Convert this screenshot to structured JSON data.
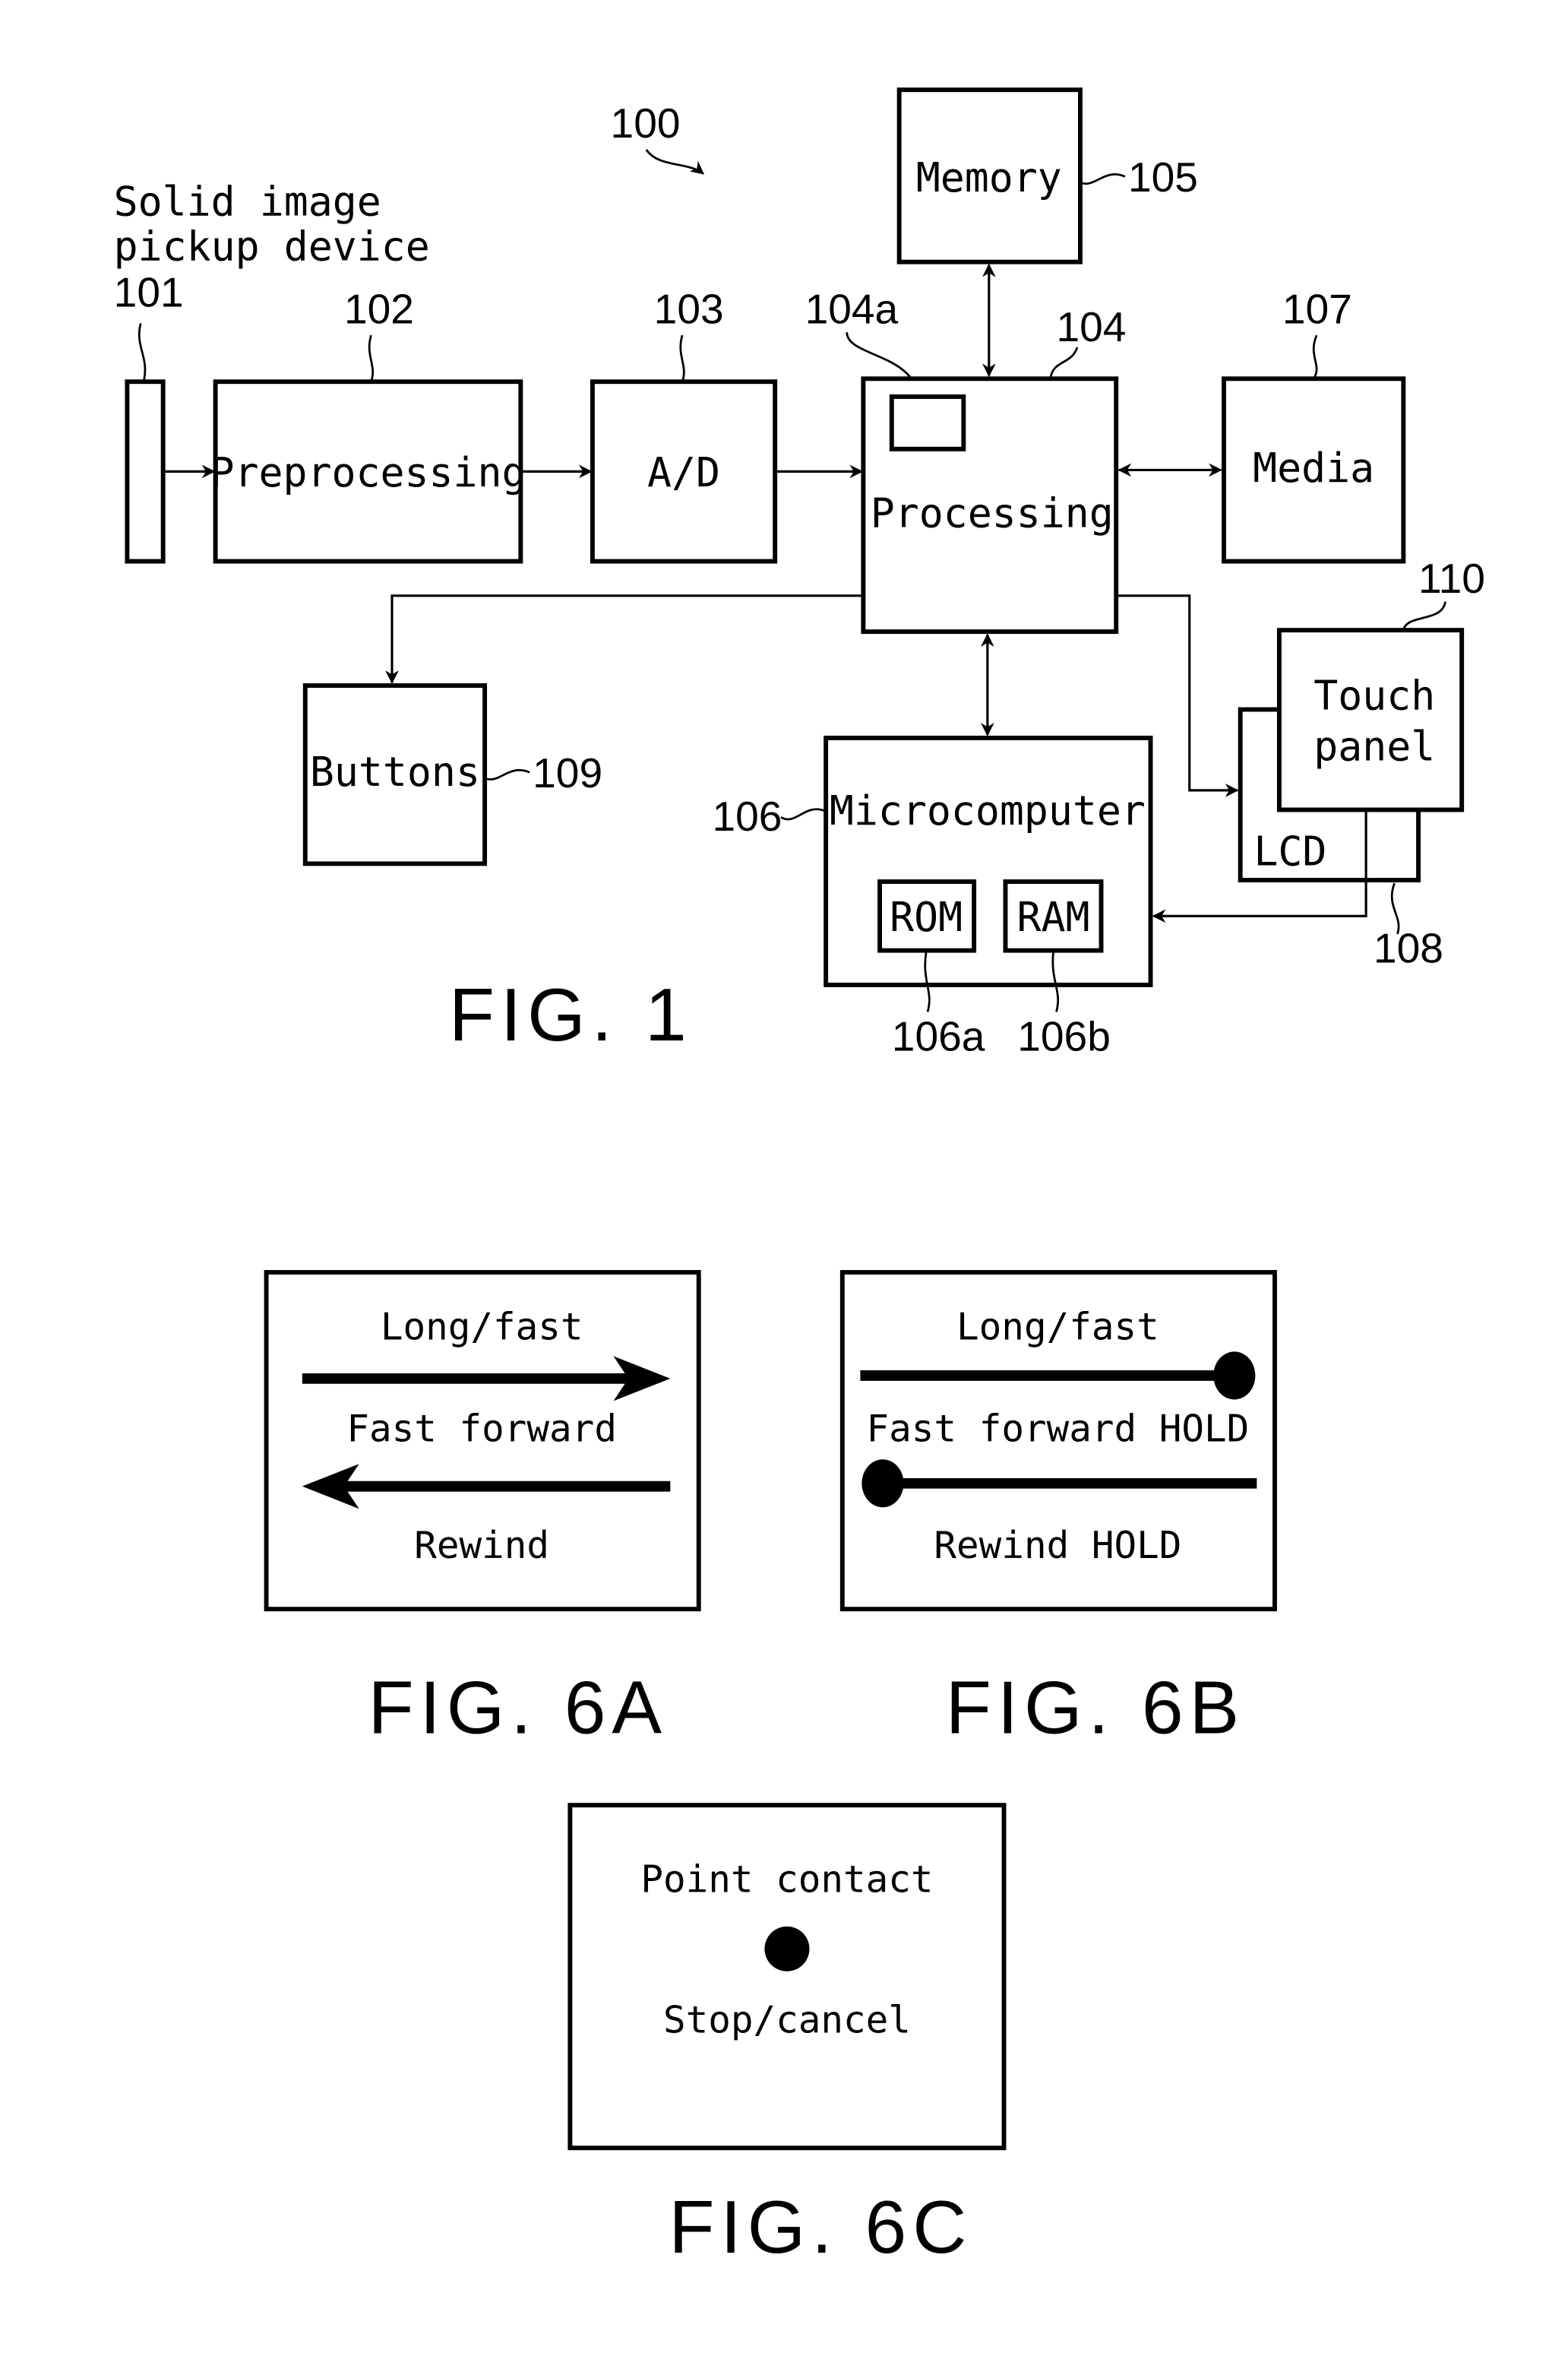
{
  "fig1": {
    "title": "FIG. 1",
    "system_ref": "100",
    "blocks": {
      "sensor": {
        "label_line1": "Solid image",
        "label_line2": "pickup device",
        "ref": "101"
      },
      "preprocessing": {
        "label": "Preprocessing",
        "ref": "102"
      },
      "ad": {
        "label": "A/D",
        "ref": "103"
      },
      "processing": {
        "label": "Processing",
        "ref": "104",
        "sub_ref": "104a"
      },
      "memory": {
        "label": "Memory",
        "ref": "105"
      },
      "microcomputer": {
        "label": "Microcomputer",
        "ref": "106",
        "rom_label": "ROM",
        "rom_ref": "106a",
        "ram_label": "RAM",
        "ram_ref": "106b"
      },
      "media": {
        "label": "Media",
        "ref": "107"
      },
      "lcd": {
        "label": "LCD",
        "ref": "108"
      },
      "buttons": {
        "label": "Buttons",
        "ref": "109"
      },
      "touch_panel": {
        "label_line1": "Touch",
        "label_line2": "panel",
        "ref": "110"
      }
    }
  },
  "fig6a": {
    "title": "FIG. 6A",
    "top_label": "Long/fast",
    "middle_label": "Fast forward",
    "bottom_label": "Rewind"
  },
  "fig6b": {
    "title": "FIG. 6B",
    "top_label": "Long/fast",
    "middle_label": "Fast forward HOLD",
    "bottom_label": "Rewind HOLD"
  },
  "fig6c": {
    "title": "FIG. 6C",
    "top_label": "Point contact",
    "bottom_label": "Stop/cancel"
  }
}
